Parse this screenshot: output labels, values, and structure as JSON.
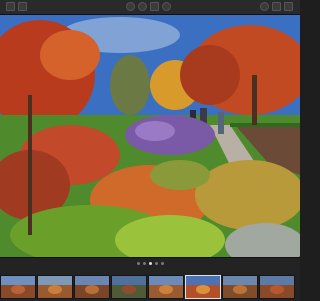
{
  "toolbar": {
    "left_icons": [
      "grid-view-icon",
      "compare-icon"
    ],
    "center_icons": [
      "rotate-left-icon",
      "rotate-right-icon",
      "crop-icon",
      "adjust-icon"
    ],
    "right_icons": [
      "info-icon",
      "heart-icon",
      "share-icon"
    ]
  },
  "viewer": {
    "photo": "autumn-garden-photo",
    "colors": {
      "sky": "#3a6fc2",
      "tree_red": "#b83b1e",
      "tree_orange": "#d7732b",
      "grass_green": "#4f8a2c",
      "lavender": "#7a5aa6",
      "path": "#b8b0a4"
    }
  },
  "filmstrip": {
    "page_dots": [
      false,
      false,
      true,
      false,
      false
    ],
    "thumbnails": [
      {
        "sky": "#6f8fbf",
        "foliage": "#8a4a2a",
        "accent": "#c06a3a",
        "label": ""
      },
      {
        "sky": "#7e98b8",
        "foliage": "#9a5a30",
        "accent": "#d3883e",
        "label": ""
      },
      {
        "sky": "#6a86b3",
        "foliage": "#7a4528",
        "accent": "#c5793a",
        "label": ""
      },
      {
        "sky": "#4f6f9c",
        "foliage": "#4e5a38",
        "accent": "#a04a2a",
        "label": ""
      },
      {
        "sky": "#6c8ab8",
        "foliage": "#9b5b32",
        "accent": "#d88c3c",
        "label": ""
      },
      {
        "sky": "#4b72b4",
        "foliage": "#b1502a",
        "accent": "#e6a040",
        "label": ""
      },
      {
        "sky": "#6b87b0",
        "foliage": "#7f4d2c",
        "accent": "#cc7a3a",
        "label": ""
      },
      {
        "sky": "#5d7aa6",
        "foliage": "#8a4a2a",
        "accent": "#c05a30",
        "label": ""
      }
    ],
    "selected_index": 5
  }
}
